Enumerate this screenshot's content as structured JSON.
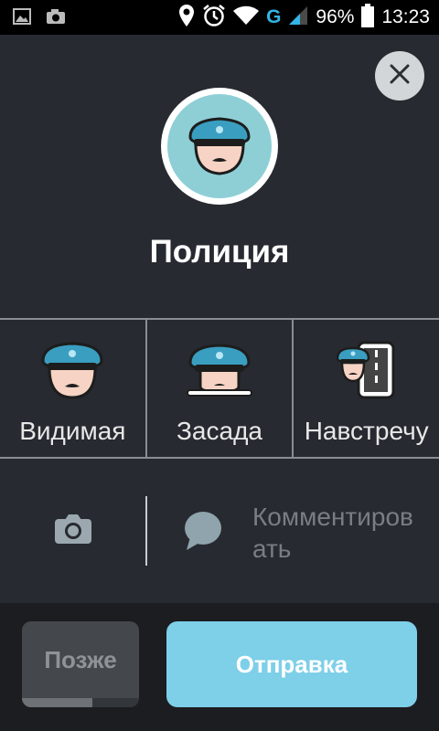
{
  "status_bar": {
    "battery": "96%",
    "time": "13:23",
    "network_type": "G",
    "icons": [
      "image-icon",
      "camera-icon",
      "location-icon",
      "alarm-icon",
      "wifi-icon",
      "signal-icon",
      "battery-icon"
    ]
  },
  "report": {
    "title": "Полиция",
    "icon": "police-officer-icon",
    "options": [
      {
        "label": "Видимая",
        "icon": "police-visible-icon"
      },
      {
        "label": "Засада",
        "icon": "police-hidden-icon"
      },
      {
        "label": "Навстречу",
        "icon": "police-other-side-icon"
      }
    ],
    "camera_icon": "camera-icon",
    "comment_label": "Комментировать",
    "comment_icon": "speech-bubble-icon"
  },
  "buttons": {
    "later_label": "Позже",
    "later_progress": 0.6,
    "send_label": "Отправка",
    "close_icon": "close-icon"
  },
  "colors": {
    "panel_bg": "#272a30",
    "accent": "#7ecfe8",
    "cap_blue": "#3a9ec0"
  }
}
